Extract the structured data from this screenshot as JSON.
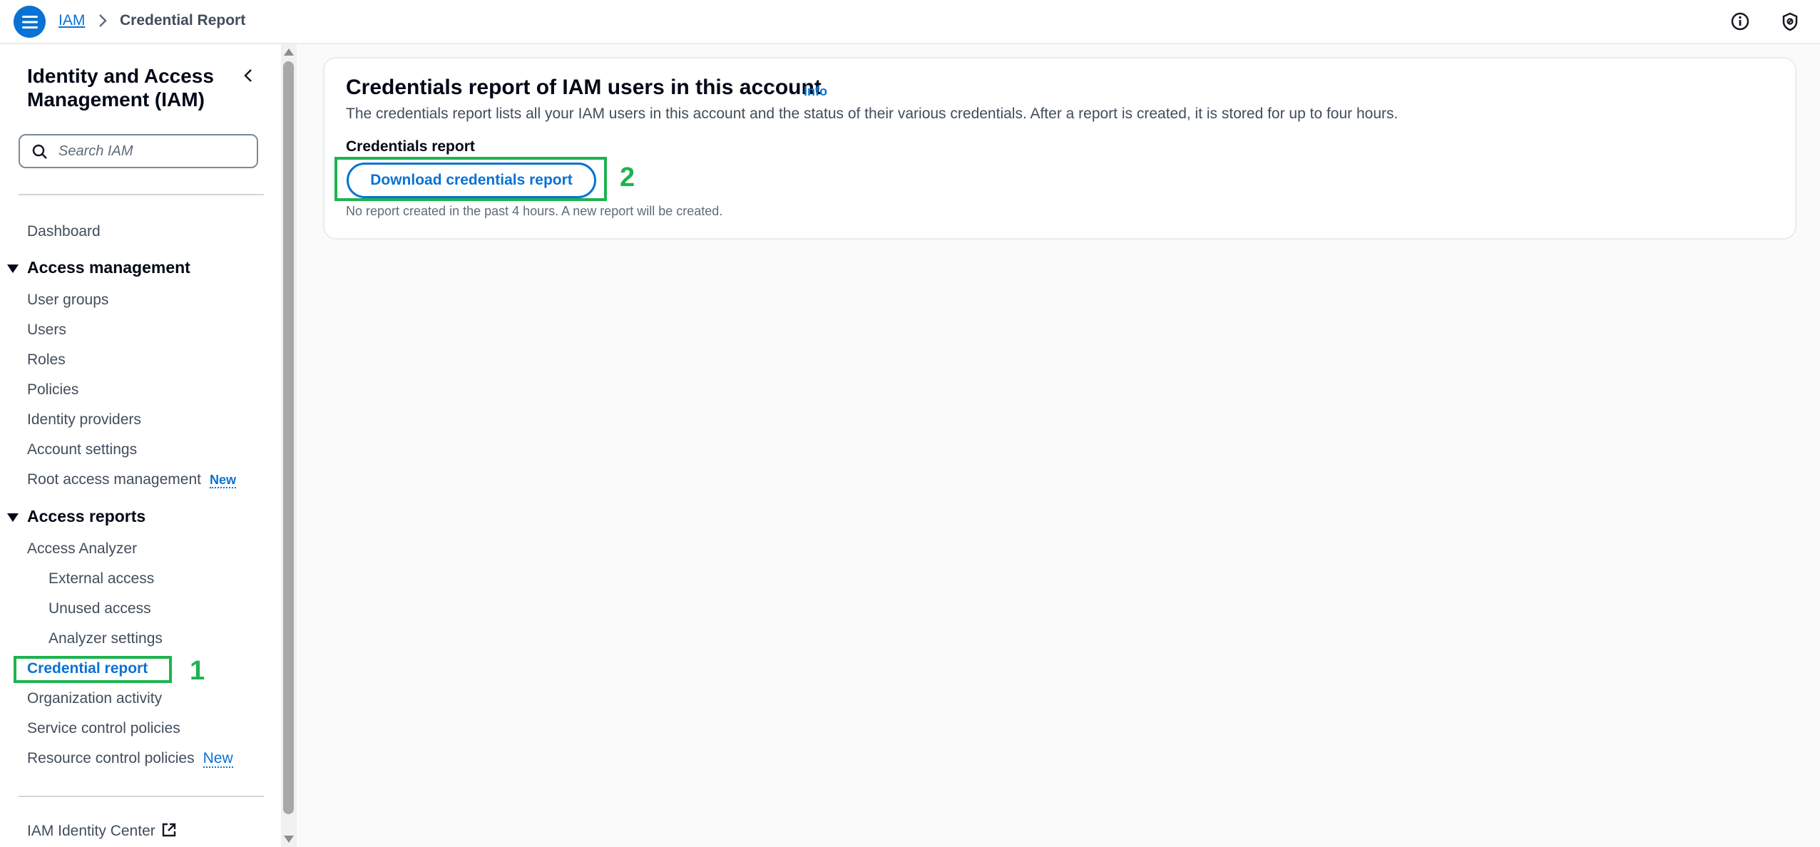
{
  "topbar": {
    "breadcrumb": [
      {
        "label": "IAM"
      },
      {
        "label": "Credential Report"
      }
    ]
  },
  "sidebar": {
    "title": "Identity and Access Management (IAM)",
    "search_placeholder": "Search IAM",
    "dashboard": "Dashboard",
    "access_management": {
      "heading": "Access management",
      "items": [
        "User groups",
        "Users",
        "Roles",
        "Policies",
        "Identity providers",
        "Account settings",
        "Root access management"
      ],
      "root_badge": "New"
    },
    "access_reports": {
      "heading": "Access reports",
      "analyzer": "Access Analyzer",
      "analyzer_items": [
        "External access",
        "Unused access",
        "Analyzer settings"
      ],
      "items": [
        "Credential report",
        "Organization activity",
        "Service control policies",
        "Resource control policies"
      ],
      "rcp_badge": "New"
    },
    "identity_center": "IAM Identity Center"
  },
  "main": {
    "title": "Credentials report of IAM users in this account",
    "info": "Info",
    "description": "The credentials report lists all your IAM users in this account and the status of their various credentials. After a report is created, it is stored for up to four hours.",
    "field_label": "Credentials report",
    "download_button": "Download credentials report",
    "help_text": "No report created in the past 4 hours. A new report will be created."
  },
  "annotations": [
    "1",
    "2"
  ],
  "colors": {
    "accent": "#0972d3",
    "annotation": "#1db34f",
    "text": "#16191f"
  }
}
